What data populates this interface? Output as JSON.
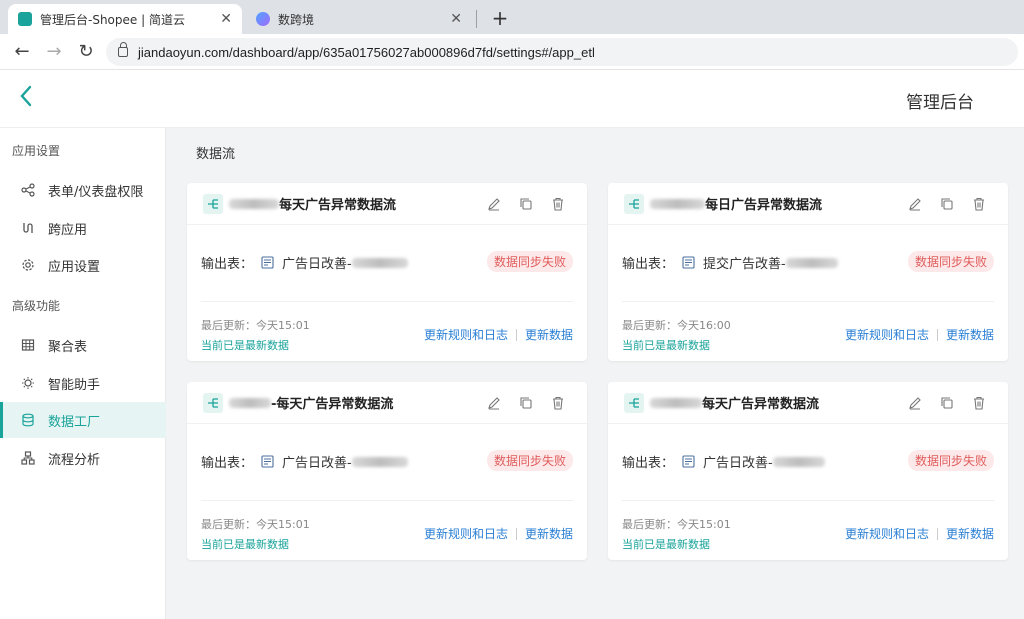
{
  "browser": {
    "tabs": [
      {
        "title": "管理后台-Shopee | 简道云",
        "active": true
      },
      {
        "title": "数跨境",
        "active": false
      }
    ],
    "url": "jiandaoyun.com/dashboard/app/635a01756027ab000896d7fd/settings#/app_etl"
  },
  "header": {
    "title": "管理后台"
  },
  "sidebar": {
    "section_app": "应用设置",
    "section_adv": "高级功能",
    "items": [
      {
        "label": "表单/仪表盘权限",
        "icon": "share-icon"
      },
      {
        "label": "跨应用",
        "icon": "link-icon"
      },
      {
        "label": "应用设置",
        "icon": "gear-icon"
      },
      {
        "label": "聚合表",
        "icon": "table-icon"
      },
      {
        "label": "智能助手",
        "icon": "bulb-icon"
      },
      {
        "label": "数据工厂",
        "icon": "database-icon",
        "active": true
      },
      {
        "label": "流程分析",
        "icon": "flow-icon"
      }
    ]
  },
  "main": {
    "title": "数据流",
    "cards": [
      {
        "title": "每天广告异常数据流",
        "output_label": "输出表：",
        "output_table": "广告日改善-",
        "status": "数据同步失败",
        "updated": "最后更新：今天15:01",
        "latest": "当前已是最新数据",
        "link_rules": "更新规则和日志",
        "link_update": "更新数据"
      },
      {
        "title": "每日广告异常数据流",
        "output_label": "输出表：",
        "output_table": "提交广告改善-",
        "status": "数据同步失败",
        "updated": "最后更新：今天16:00",
        "latest": "当前已是最新数据",
        "link_rules": "更新规则和日志",
        "link_update": "更新数据"
      },
      {
        "title": "-每天广告异常数据流",
        "output_label": "输出表：",
        "output_table": "广告日改善-",
        "status": "数据同步失败",
        "updated": "最后更新：今天15:01",
        "latest": "当前已是最新数据",
        "link_rules": "更新规则和日志",
        "link_update": "更新数据"
      },
      {
        "title": "每天广告异常数据流",
        "output_label": "输出表：",
        "output_table": "广告日改善-",
        "status": "数据同步失败",
        "updated": "最后更新：今天15:01",
        "latest": "当前已是最新数据",
        "link_rules": "更新规则和日志",
        "link_update": "更新数据"
      }
    ]
  },
  "colors": {
    "accent": "#1aa39a",
    "error": "#e05d5d",
    "link": "#2a7fd4"
  }
}
